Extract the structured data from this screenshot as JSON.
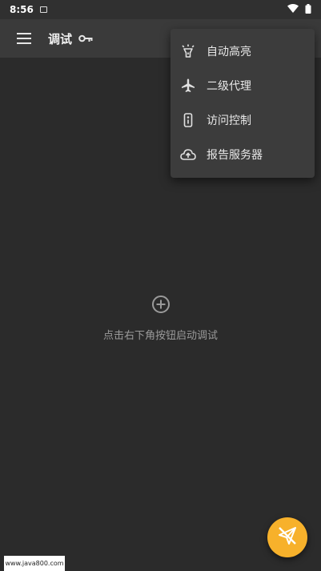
{
  "status_bar": {
    "time": "8:56",
    "icons": [
      "notification-icon",
      "wifi-icon",
      "battery-icon"
    ]
  },
  "app_bar": {
    "title": "调试",
    "menu_icon": "hamburger-menu-icon",
    "title_icon": "key-icon"
  },
  "overflow_menu": {
    "items": [
      {
        "label": "自动高亮",
        "icon": "lamp-icon"
      },
      {
        "label": "二级代理",
        "icon": "airplane-icon"
      },
      {
        "label": "访问控制",
        "icon": "remote-icon"
      },
      {
        "label": "报告服务器",
        "icon": "cloud-upload-icon"
      }
    ]
  },
  "empty_state": {
    "icon": "add-circle-icon",
    "message": "点击右下角按钮启动调试"
  },
  "fab": {
    "icon": "send-off-icon"
  },
  "watermark": {
    "text": "www.java800.com"
  },
  "colors": {
    "background": "#2b2b2b",
    "app_bar": "#3a3a3a",
    "menu": "#3c3c3c",
    "fab": "#f7b12b"
  }
}
